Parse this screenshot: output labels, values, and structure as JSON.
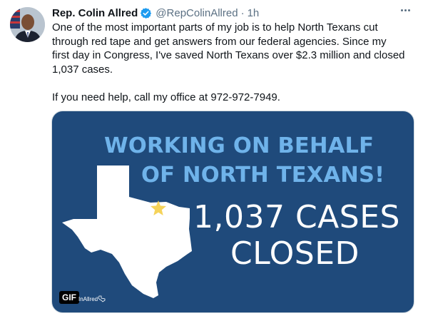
{
  "tweet": {
    "display_name": "Rep. Colin Allred",
    "handle": "@RepColinAllred",
    "separator": "·",
    "time": "1h",
    "text": "One of the most important parts of my job is to help North Texans cut\nthrough red tape and get answers from our federal agencies. Since my\nfirst day in Congress, I've saved North Texans over $2.3 million and closed\n1,037 cases.\n\nIf you need help, call my office at 972-972-7949.",
    "verified": true
  },
  "icons": {
    "verified": "verified-badge-icon",
    "more": "more-options-icon",
    "star": "star-icon"
  },
  "media": {
    "headline_line1": "WORKING ON BEHALF",
    "headline_line2": "OF NORTH TEXANS!",
    "big_line1": "1,037 CASES",
    "big_line2": "CLOSED",
    "gif_badge": "GIF",
    "watermark": "InAllred"
  },
  "colors": {
    "media_background": "#1f4a7b",
    "headline": "#6fb3ea",
    "star": "#f5d35a",
    "verified": "#1d9bf0"
  }
}
